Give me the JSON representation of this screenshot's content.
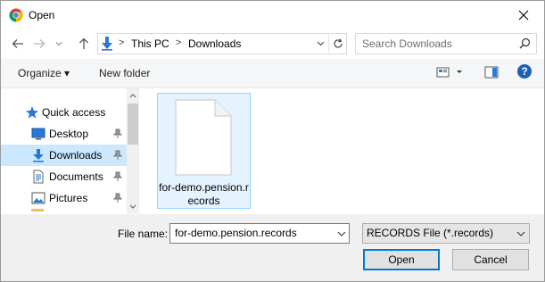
{
  "window": {
    "title": "Open",
    "app_icon": "chrome-icon",
    "close_icon": "close-icon"
  },
  "nav": {
    "back_icon": "arrow-left-icon",
    "forward_icon": "arrow-right-icon",
    "recent_icon": "chevron-down-icon",
    "up_icon": "arrow-up-icon",
    "address": {
      "icon": "download-arrow-icon",
      "crumbs": [
        "This PC",
        "Downloads"
      ],
      "separator": ">"
    },
    "refresh_icon": "refresh-icon",
    "search": {
      "placeholder": "Search Downloads",
      "icon": "search-icon"
    }
  },
  "toolbar": {
    "organize_label": "Organize ▾",
    "new_folder_label": "New folder",
    "view_icon": "view-icon",
    "preview_icon": "preview-pane-icon",
    "help_label": "?"
  },
  "navpane": {
    "quick_access": "Quick access",
    "items": [
      {
        "label": "Desktop",
        "icon": "desktop-icon",
        "pinned": true
      },
      {
        "label": "Downloads",
        "icon": "download-arrow-icon",
        "pinned": true,
        "selected": true
      },
      {
        "label": "Documents",
        "icon": "documents-icon",
        "pinned": true
      },
      {
        "label": "Pictures",
        "icon": "pictures-icon",
        "pinned": true
      }
    ]
  },
  "files": [
    {
      "name": "for-demo.pension.records",
      "icon": "file-icon",
      "selected": true
    }
  ],
  "bottom": {
    "filename_label": "File name:",
    "filename_value": "for-demo.pension.records",
    "filetype_value": "RECORDS File (*.records)",
    "open_label": "Open",
    "cancel_label": "Cancel"
  },
  "colors": {
    "selection": "#cce8ff",
    "tile_border": "#99d1ff",
    "accent": "#0078d7"
  }
}
